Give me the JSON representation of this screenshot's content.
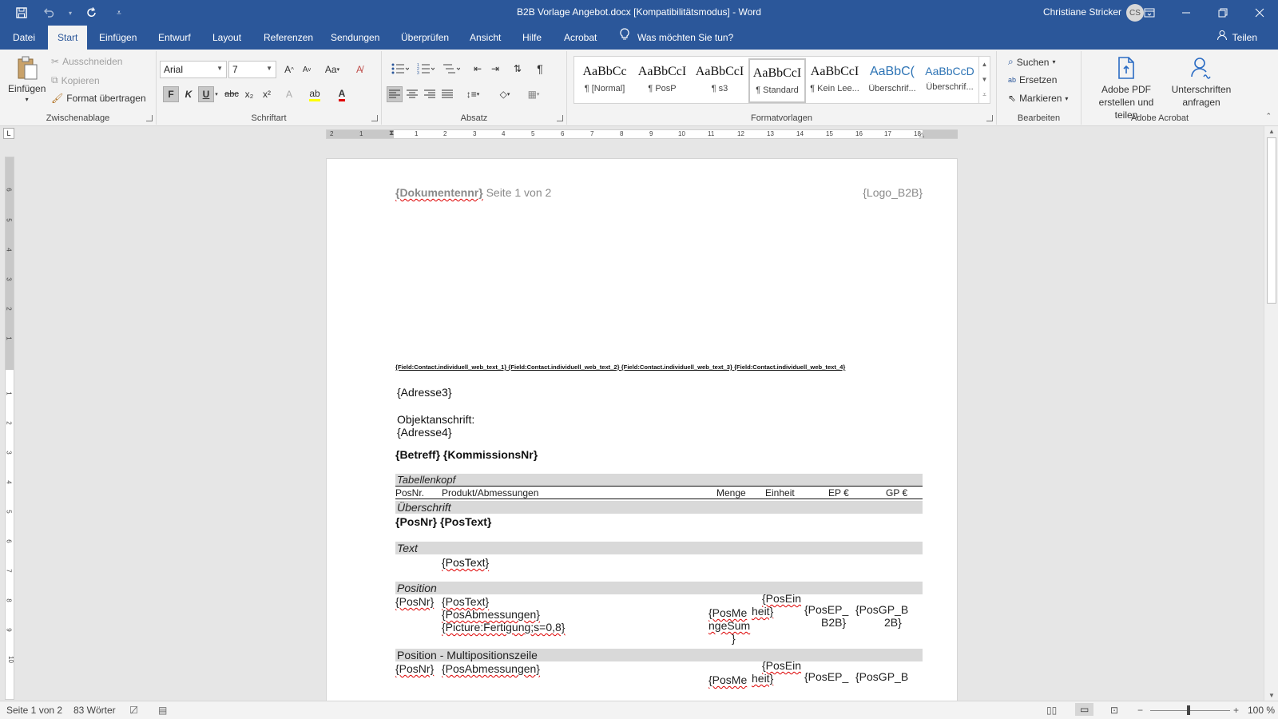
{
  "window": {
    "title": "B2B Vorlage Angebot.docx [Kompatibilitätsmodus]  -  Word",
    "user_name": "Christiane Stricker",
    "user_initials": "CS"
  },
  "tabs": [
    {
      "label": "Datei"
    },
    {
      "label": "Start"
    },
    {
      "label": "Einfügen"
    },
    {
      "label": "Entwurf"
    },
    {
      "label": "Layout"
    },
    {
      "label": "Referenzen"
    },
    {
      "label": "Sendungen"
    },
    {
      "label": "Überprüfen"
    },
    {
      "label": "Ansicht"
    },
    {
      "label": "Hilfe"
    },
    {
      "label": "Acrobat"
    }
  ],
  "tell_me": "Was möchten Sie tun?",
  "share_label": "Teilen",
  "ribbon": {
    "clipboard": {
      "paste": "Einfügen",
      "cut": "Ausschneiden",
      "copy": "Kopieren",
      "format_painter": "Format übertragen",
      "label": "Zwischenablage"
    },
    "font": {
      "family": "Arial",
      "size": "7",
      "label": "Schriftart",
      "bold": "F",
      "italic": "K",
      "underline": "U",
      "strike": "abc",
      "sub": "x₂",
      "sup": "x²",
      "change_case": "Aa"
    },
    "paragraph": {
      "label": "Absatz"
    },
    "styles": {
      "label": "Formatvorlagen",
      "items": [
        {
          "sample": "AaBbCc",
          "name": "¶ [Normal]"
        },
        {
          "sample": "AaBbCcI",
          "name": "¶ PosP"
        },
        {
          "sample": "AaBbCcI",
          "name": "¶ s3"
        },
        {
          "sample": "AaBbCcI",
          "name": "¶ Standard"
        },
        {
          "sample": "AaBbCcI",
          "name": "¶ Kein Lee..."
        },
        {
          "sample": "AaBbC(",
          "name": "Überschrif..."
        },
        {
          "sample": "AaBbCcD",
          "name": "Überschrif..."
        }
      ]
    },
    "editing": {
      "label": "Bearbeiten",
      "find": "Suchen",
      "replace": "Ersetzen",
      "select": "Markieren"
    },
    "acrobat": {
      "label": "Adobe Acrobat",
      "create_pdf_line1": "Adobe PDF",
      "create_pdf_line2": "erstellen und teilen",
      "signatures_line1": "Unterschriften",
      "signatures_line2": "anfragen"
    }
  },
  "ruler": {
    "h_numbers": [
      "2",
      "1",
      "1",
      "2",
      "3",
      "4",
      "5",
      "6",
      "7",
      "8",
      "9",
      "10",
      "11",
      "12",
      "13",
      "14",
      "15",
      "16",
      "17",
      "18"
    ],
    "v_numbers": [
      "6",
      "5",
      "4",
      "3",
      "2",
      "1",
      "1",
      "2",
      "3",
      "4",
      "5",
      "6",
      "7",
      "8",
      "9",
      "10"
    ]
  },
  "document": {
    "header_field": "{Dokumentennr}",
    "header_page": " Seite 1 von 2",
    "header_logo": "{Logo_B2B}",
    "contact_fields": "{Field:Contact.individuell_web_text_1} {Field:Contact.individuell_web_text_2} {Field:Contact.individuell_web_text_3} {Field:Contact.individuell_web_text_4}",
    "address3": "{Adresse3}",
    "object_label": "Objektanschrift:",
    "address4": "{Adresse4}",
    "subject": "{Betreff} {KommissionsNr}",
    "table_head_band": "Tabellenkopf",
    "columns": [
      "PosNr.",
      "Produkt/Abmessungen",
      "Menge",
      "Einheit",
      "EP €",
      "GP €"
    ],
    "heading_band": "Überschrift",
    "heading_row": "{PosNr} {PosText}",
    "text_band": "Text",
    "text_row": "{PosText}",
    "position_band": "Position",
    "position": {
      "posnr": "{PosNr}",
      "postext": "{PosText}",
      "abmessungen": "{PosAbmessungen}",
      "picture": "{Picture:Fertigung;s=0,8}",
      "menge_l1": "{PosMe",
      "menge_l2": "ngeSum",
      "menge_l3": "}",
      "einheit_l1": "{PosEin",
      "einheit_l2": "heit}",
      "ep_l1": "{PosEP_",
      "ep_l2": "B2B}",
      "gp_l1": "{PosGP_B",
      "gp_l2": "2B}"
    },
    "multi_band": "Position - Multipositionszeile",
    "multi": {
      "posnr": "{PosNr}",
      "abmessungen": "{PosAbmessungen}",
      "menge_l1": "{PosMe",
      "einheit_l1": "{PosEin",
      "einheit_l2": "heit}",
      "ep_l1": "{PosEP_",
      "gp_l1": "{PosGP_B"
    }
  },
  "status": {
    "page": "Seite 1 von 2",
    "words": "83 Wörter",
    "zoom": "100 %"
  }
}
